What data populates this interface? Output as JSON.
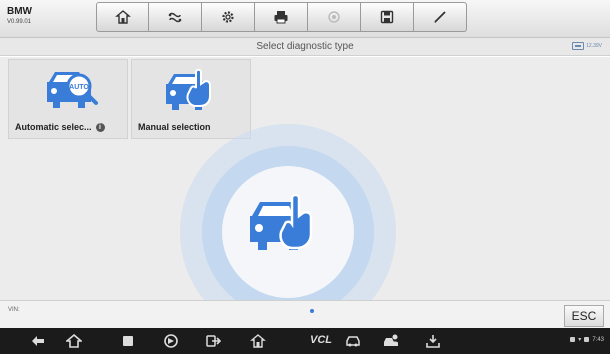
{
  "header": {
    "make": "BMW",
    "version": "V0.99.01",
    "toolbar": [
      {
        "icon": "home-icon"
      },
      {
        "icon": "vehicle-swap-icon"
      },
      {
        "icon": "settings-icon"
      },
      {
        "icon": "print-icon"
      },
      {
        "icon": "help-icon"
      },
      {
        "icon": "save-icon"
      },
      {
        "icon": "data-logging-icon"
      }
    ]
  },
  "titlebar": {
    "title": "Select diagnostic type",
    "battery": "12.39V"
  },
  "tiles": [
    {
      "label": "Automatic selec...",
      "icon": "auto-detect-car-icon",
      "info": "i"
    },
    {
      "label": "Manual selection",
      "icon": "manual-select-car-icon"
    }
  ],
  "bottombar": {
    "vin_label": "VIN:",
    "esc_label": "ESC"
  },
  "navbar": {
    "vcl_label": "VCL",
    "time": "7:43",
    "icons": [
      "back-icon",
      "home-icon",
      "recents-icon",
      "browser-icon",
      "exit-icon",
      "maxifix-home-icon",
      "vcl-icon",
      "car-icon",
      "shop-manager-icon",
      "update-icon"
    ]
  },
  "colors": {
    "accent": "#3a7dd8",
    "ripple": "#9ec0e8"
  }
}
